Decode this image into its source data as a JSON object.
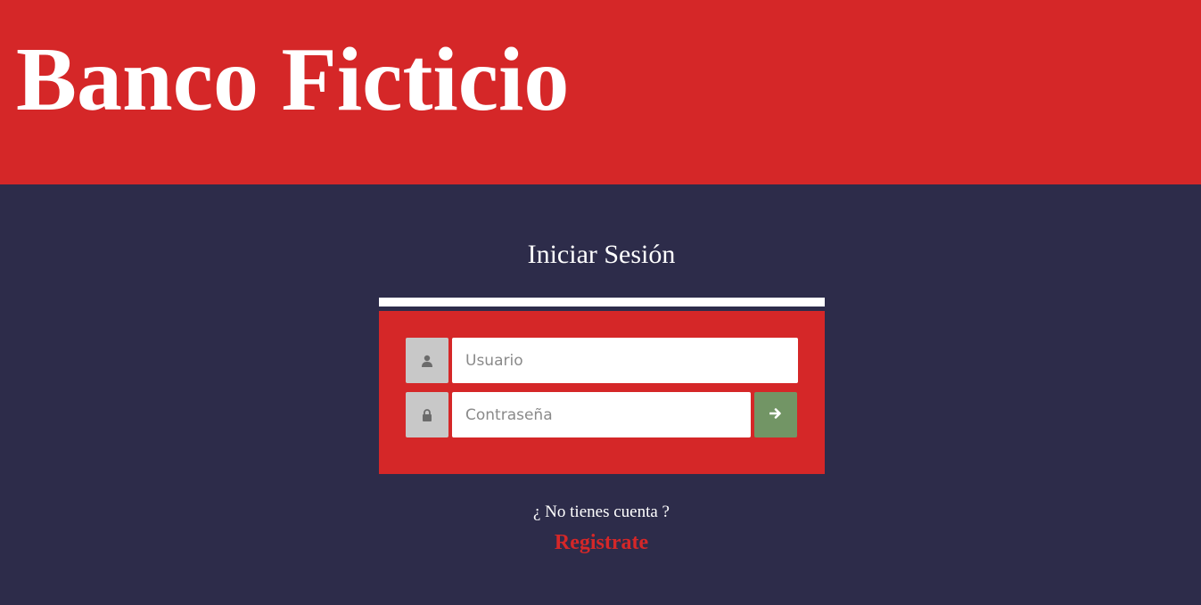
{
  "header": {
    "brand": "Banco Ficticio"
  },
  "login": {
    "title": "Iniciar Sesión",
    "username": {
      "placeholder": "Usuario",
      "value": "",
      "icon": "user-icon"
    },
    "password": {
      "placeholder": "Contraseña",
      "value": "",
      "icon": "lock-icon"
    },
    "submit_icon": "arrow-right-icon"
  },
  "footer": {
    "no_account_text": "¿ No tienes cuenta ?",
    "register_label": "Registrate"
  },
  "colors": {
    "brand_red": "#d52728",
    "background_navy": "#2d2c4a",
    "addon_gray": "#c8c8c8",
    "submit_green": "#729565"
  }
}
